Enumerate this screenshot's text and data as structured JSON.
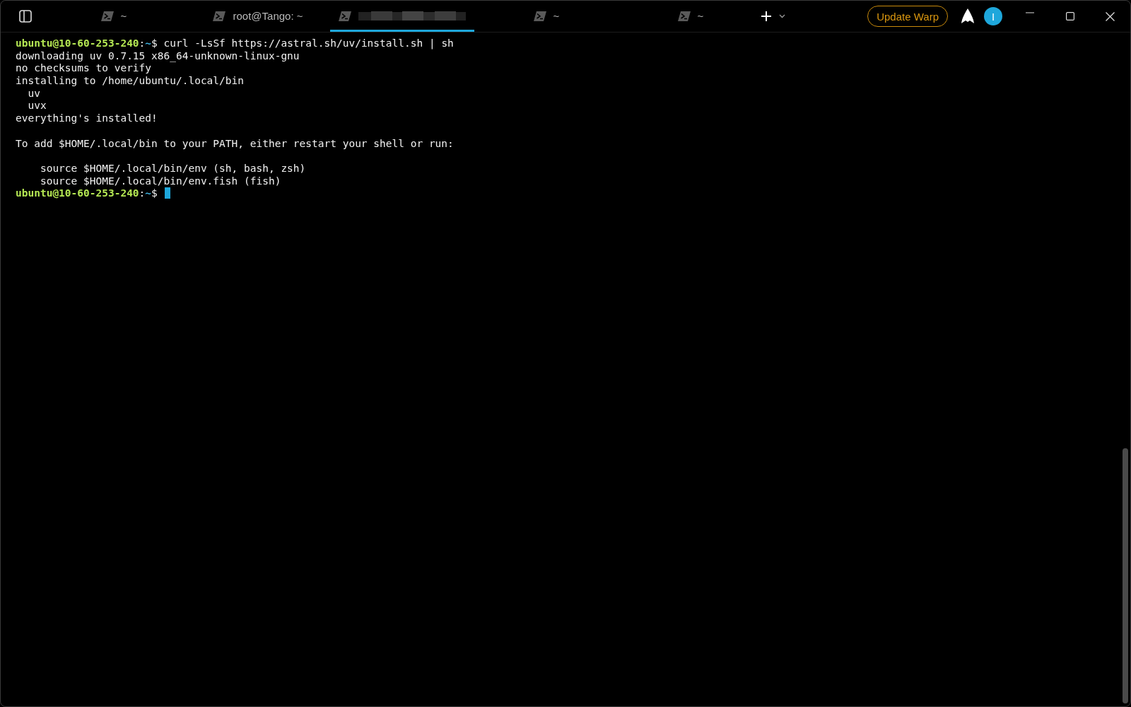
{
  "tabs": [
    {
      "kind": "titled",
      "label": "~",
      "selected": false
    },
    {
      "kind": "titled",
      "label": "root@Tango: ~",
      "selected": false
    },
    {
      "kind": "redacted",
      "selected": true
    },
    {
      "kind": "titled",
      "label": "~",
      "selected": false
    },
    {
      "kind": "titled",
      "label": "~",
      "selected": false
    }
  ],
  "update_button": "Update Warp",
  "avatar": {
    "initial": "I",
    "color": "#1ea7db"
  },
  "terminal": {
    "lines": [
      {
        "kind": "prompt",
        "user": "ubuntu@10-60-253-240",
        "separator": ":",
        "cwd": "~",
        "symbol": "$",
        "command": "curl -LsSf https://astral.sh/uv/install.sh | sh",
        "cursor": false
      },
      {
        "kind": "output",
        "text": "downloading uv 0.7.15 x86_64-unknown-linux-gnu"
      },
      {
        "kind": "output",
        "text": "no checksums to verify"
      },
      {
        "kind": "output",
        "text": "installing to /home/ubuntu/.local/bin"
      },
      {
        "kind": "output",
        "text": "  uv"
      },
      {
        "kind": "output",
        "text": "  uvx"
      },
      {
        "kind": "output",
        "text": "everything's installed!"
      },
      {
        "kind": "blank"
      },
      {
        "kind": "output",
        "text": "To add $HOME/.local/bin to your PATH, either restart your shell or run:"
      },
      {
        "kind": "blank"
      },
      {
        "kind": "output",
        "text": "    source $HOME/.local/bin/env (sh, bash, zsh)"
      },
      {
        "kind": "output",
        "text": "    source $HOME/.local/bin/env.fish (fish)"
      },
      {
        "kind": "prompt",
        "user": "ubuntu@10-60-253-240",
        "separator": ":",
        "cwd": "~",
        "symbol": "$",
        "cursor": true
      }
    ]
  }
}
